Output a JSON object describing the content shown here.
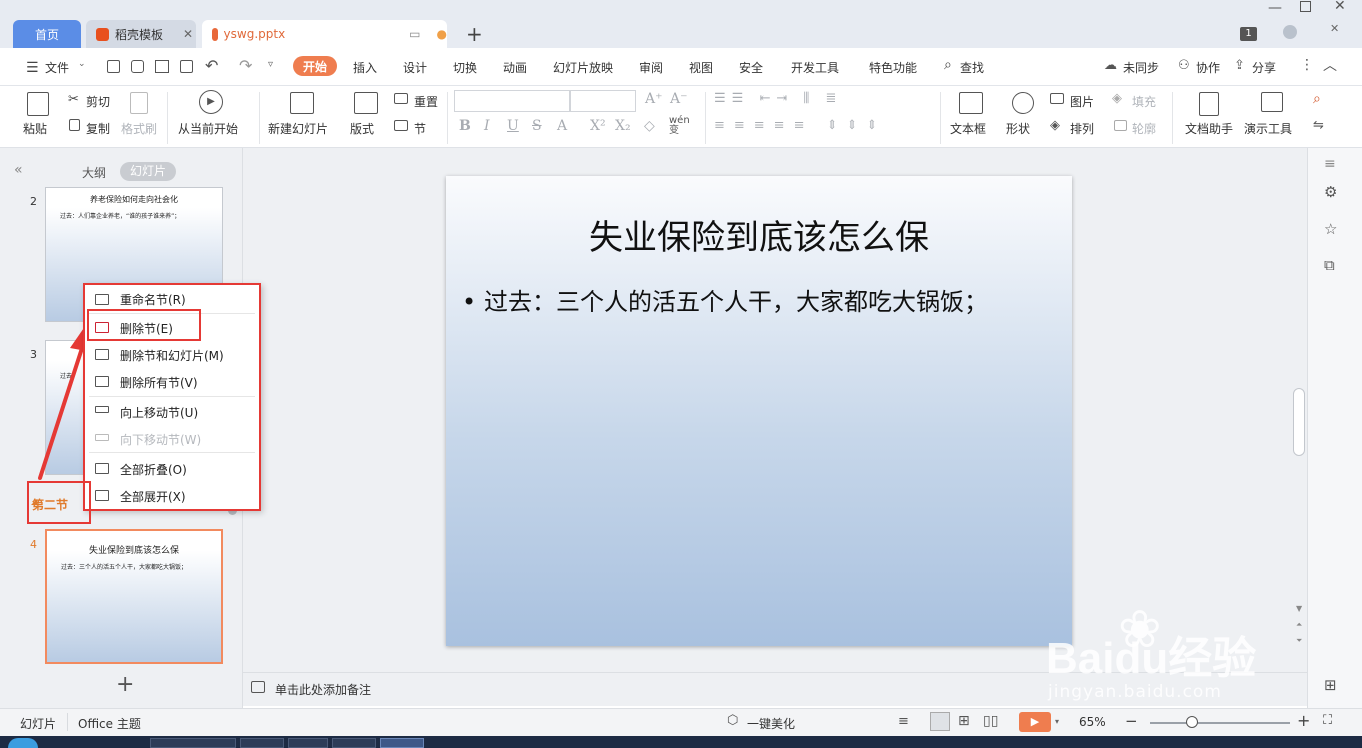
{
  "tabs": {
    "home": "首页",
    "template": "稻壳模板",
    "file": "yswg.pptx",
    "badge": "1"
  },
  "menu": {
    "file": "文件",
    "items": [
      "开始",
      "插入",
      "设计",
      "切换",
      "动画",
      "幻灯片放映",
      "审阅",
      "视图",
      "安全",
      "开发工具",
      "特色功能",
      "查找"
    ],
    "right": {
      "sync": "未同步",
      "collab": "协作",
      "share": "分享"
    }
  },
  "ribbon": {
    "paste": "粘贴",
    "cut": "剪切",
    "copy": "复制",
    "format_brush": "格式刷",
    "from_current": "从当前开始",
    "new_slide": "新建幻灯片",
    "layout": "版式",
    "reset": "重置",
    "section": "节",
    "textbox": "文本框",
    "shape": "形状",
    "picture": "图片",
    "fill": "填充",
    "arrange": "排列",
    "outline": "轮廓",
    "doc_helper": "文档助手",
    "present_tool": "演示工具",
    "wen": "wén"
  },
  "pane": {
    "outline_tab": "大纲",
    "slides_tab": "幻灯片"
  },
  "thumbnails": [
    {
      "num": "2",
      "title": "养老保险如何走向社会化",
      "body": "过去：人们靠企业养老，“谁的孩子谁来养”；"
    },
    {
      "num": "3",
      "title": "",
      "body": "过去"
    },
    {
      "num": "4",
      "title": "失业保险到底该怎么保",
      "body": "过去：三个人的活五个人干，大家都吃大锅饭；"
    }
  ],
  "section_label": "第二节",
  "context_menu": [
    {
      "label": "重命名节(R)",
      "enabled": true
    },
    {
      "label": "删除节(E)",
      "enabled": true
    },
    {
      "label": "删除节和幻灯片(M)",
      "enabled": true
    },
    {
      "label": "删除所有节(V)",
      "enabled": true
    },
    {
      "label": "向上移动节(U)",
      "enabled": true
    },
    {
      "label": "向下移动节(W)",
      "enabled": false
    },
    {
      "label": "全部折叠(O)",
      "enabled": true
    },
    {
      "label": "全部展开(X)",
      "enabled": true
    }
  ],
  "slide": {
    "title": "失业保险到底该怎么保",
    "bullet": "过去：三个人的活五个人干，大家都吃大锅饭；"
  },
  "notes_placeholder": "单击此处添加备注",
  "status": {
    "slides": "幻灯片",
    "theme": "Office 主题",
    "beautify": "一键美化",
    "zoom": "65%"
  },
  "watermark": {
    "brand": "Baidu经验",
    "url": "jingyan.baidu.com"
  },
  "colors": {
    "accent": "#ef7d4f",
    "highlight": "#e53935",
    "home_tab": "#5b8de6"
  }
}
